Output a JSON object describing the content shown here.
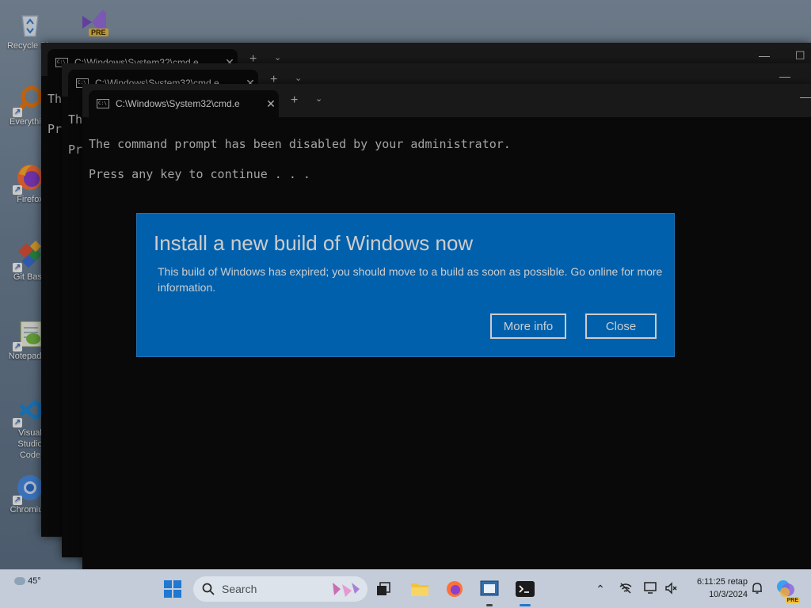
{
  "desktop": {
    "icons": [
      {
        "label": "Recycle Bin",
        "icon": "recycle-bin-icon"
      },
      {
        "label": "",
        "icon": "visual-studio-preview-icon",
        "badge": "PRE"
      },
      {
        "label": "Everything",
        "icon": "everything-search-icon"
      },
      {
        "label": "Firefox",
        "icon": "firefox-icon"
      },
      {
        "label": "Git Bash",
        "icon": "git-bash-icon"
      },
      {
        "label": "Notepad++",
        "icon": "notepad-plus-plus-icon"
      },
      {
        "label": "Visual Studio Code",
        "icon": "vscode-icon"
      },
      {
        "label": "Chromium",
        "icon": "chromium-icon"
      }
    ]
  },
  "windows": [
    {
      "tab_title": "C:\\Windows\\System32\\cmd.e",
      "line1": "Th",
      "line2": "Pr"
    },
    {
      "tab_title": "C:\\Windows\\System32\\cmd.e",
      "line1": "Th",
      "line2": "Pr"
    },
    {
      "tab_title": "C:\\Windows\\System32\\cmd.e",
      "line1": "The command prompt has been disabled by your administrator.",
      "line2": "Press any key to continue . . ."
    }
  ],
  "tab_controls": {
    "new_tab": "+",
    "dropdown": "⌄",
    "close": "✕",
    "minimize": "—",
    "maximize": "☐"
  },
  "dialog": {
    "title": "Install a new build of Windows now",
    "message": "This build of Windows has expired; you should move to a build as soon as possible. Go online for more information.",
    "more_info_label": "More info",
    "close_label": "Close",
    "background_color": "#0078d7"
  },
  "taskbar": {
    "weather_temp": "45°",
    "search_placeholder": "Search",
    "clock_time": "6:11:25 retap",
    "clock_date": "10/3/2024",
    "copilot_badge": "PRE"
  }
}
